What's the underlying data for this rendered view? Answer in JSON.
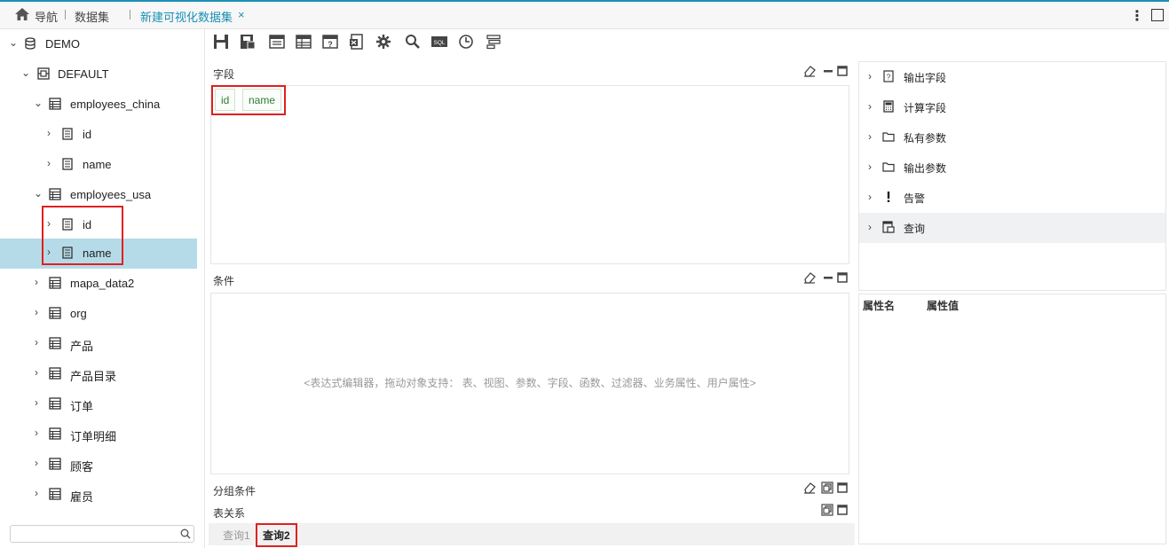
{
  "topbar": {
    "nav_label": "导航",
    "dataset_label": "数据集",
    "active_tab": "新建可视化数据集",
    "close_glyph": "×",
    "more_glyph": "⋮"
  },
  "tree": {
    "items": [
      {
        "label": "DEMO",
        "icon": "database-icon"
      },
      {
        "label": "DEFAULT",
        "icon": "schema-icon"
      },
      {
        "label": "employees_china",
        "icon": "table-icon"
      },
      {
        "label": "id",
        "icon": "field-icon"
      },
      {
        "label": "name",
        "icon": "field-icon"
      },
      {
        "label": "employees_usa",
        "icon": "table-icon"
      },
      {
        "label": "id",
        "icon": "field-icon"
      },
      {
        "label": "name",
        "icon": "field-icon",
        "selected": true
      },
      {
        "label": "mapa_data2",
        "icon": "table-icon"
      },
      {
        "label": "org",
        "icon": "table-icon"
      },
      {
        "label": "产品",
        "icon": "table-icon"
      },
      {
        "label": "产品目录",
        "icon": "table-icon"
      },
      {
        "label": "订单",
        "icon": "table-icon"
      },
      {
        "label": "订单明细",
        "icon": "table-icon"
      },
      {
        "label": "顾客",
        "icon": "table-icon"
      },
      {
        "label": "雇员",
        "icon": "table-icon"
      }
    ],
    "search_placeholder": ""
  },
  "toolbar": {
    "icons": [
      "save-icon",
      "save-as-icon",
      "layout-icon",
      "table-layout-icon",
      "help-table-icon",
      "export-icon",
      "settings-icon",
      "search-icon",
      "sql-icon",
      "history-icon",
      "filter-settings-icon"
    ],
    "sql_text": "SQL"
  },
  "fields_panel": {
    "title": "字段",
    "chips": [
      "id",
      "name"
    ]
  },
  "condition_panel": {
    "title": "条件",
    "placeholder": "<表达式编辑器，拖动对象支持： 表、视图、参数、字段、函数、过滤器、业务属性、用户属性>"
  },
  "group_panel": {
    "title": "分组条件"
  },
  "relation_panel": {
    "title": "表关系"
  },
  "query_tabs": [
    "查询1",
    "查询2"
  ],
  "right_panel": {
    "items": [
      {
        "label": "输出字段",
        "icon": "output-field-icon"
      },
      {
        "label": "计算字段",
        "icon": "calculator-icon"
      },
      {
        "label": "私有参数",
        "icon": "folder-icon"
      },
      {
        "label": "输出参数",
        "icon": "folder-icon"
      },
      {
        "label": "告警",
        "icon": "exclamation-icon"
      },
      {
        "label": "查询",
        "icon": "query-icon",
        "selected": true
      }
    ],
    "prop_name_header": "属性名",
    "prop_value_header": "属性值"
  },
  "colors": {
    "accent": "#1a8fb5",
    "selected_row": "#b5dbe9",
    "highlight_box": "#e02020",
    "chip_text": "#2e7d32"
  }
}
